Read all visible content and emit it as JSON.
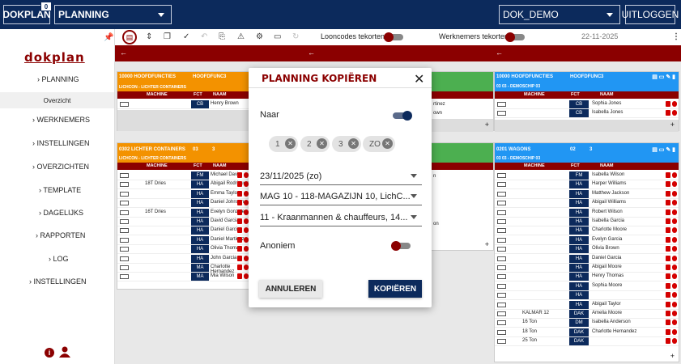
{
  "topbar": {
    "app_label": "DOKPLAN",
    "badge": "0",
    "module": "PLANNING",
    "environment": "DOK_DEMO",
    "logout": "UITLOGGEN"
  },
  "sidebar": {
    "logo": "dokplan",
    "items": [
      {
        "label": "PLANNING"
      },
      {
        "label": "Overzicht"
      },
      {
        "label": "WERKNEMERS"
      },
      {
        "label": "INSTELLINGEN"
      },
      {
        "label": "OVERZICHTEN"
      },
      {
        "label": "TEMPLATE"
      },
      {
        "label": "DAGELIJKS"
      },
      {
        "label": "RAPPORTEN"
      },
      {
        "label": "LOG"
      },
      {
        "label": "INSTELLINGEN"
      }
    ]
  },
  "toolbar": {
    "looncodes": "Looncodes tekorten",
    "werknemers": "Werknemers tekorten",
    "date": "22-11-2025"
  },
  "colors": {
    "navy": "#0c2a5c",
    "red": "#8b0000",
    "orange": "#f39200",
    "green": "#4caf50",
    "blue": "#2196f3"
  },
  "cards": {
    "c1": {
      "code": "10000 HOOFDFUNCTIES",
      "type": "HOOFDFUNC",
      "num": "3",
      "sub": "LICHCON - LICHTER CONTAINERS",
      "h_machine": "MACHINE",
      "h_fct": "FCT",
      "h_naam": "NAAM",
      "rows": [
        {
          "m": "",
          "f": "CB",
          "n": "Henry Brown"
        }
      ]
    },
    "c2": {
      "code": "0302 LICHTER CONTAINERS",
      "type": "03",
      "num": "3",
      "sub": "LICHCON - LICHTER CONTAINERS",
      "h_machine": "MACHINE",
      "h_fct": "FCT",
      "h_naam": "NAAM",
      "rows": [
        {
          "m": "",
          "f": "FM",
          "n": "Michael Davis"
        },
        {
          "m": "18T Dries",
          "f": "HA",
          "n": "Abigail Rodriguez"
        },
        {
          "m": "",
          "f": "HA",
          "n": "Emma Taylor"
        },
        {
          "m": "",
          "f": "HA",
          "n": "Daniel Johnson"
        },
        {
          "m": "16T Dries",
          "f": "HA",
          "n": "Evelyn Gonzalez"
        },
        {
          "m": "",
          "f": "HA",
          "n": "David Garcia"
        },
        {
          "m": "",
          "f": "HA",
          "n": "Daniel Garcia"
        },
        {
          "m": "",
          "f": "HA",
          "n": "Daniel Martinez"
        },
        {
          "m": "",
          "f": "HA",
          "n": "Olivia Thomas"
        },
        {
          "m": "",
          "f": "HA",
          "n": "John Garcia"
        },
        {
          "m": "",
          "f": "MA",
          "n": "Charlotte Hernandez"
        },
        {
          "m": "",
          "f": "MA",
          "n": "Mia Wilson"
        }
      ]
    },
    "c3": {
      "rows": [
        {
          "n": "rtinez"
        },
        {
          "n": "own"
        }
      ]
    },
    "c4": {
      "rows": [
        {
          "n": "n"
        },
        {
          "n": ""
        },
        {
          "n": ""
        },
        {
          "n": ""
        },
        {
          "n": ""
        },
        {
          "n": "on"
        }
      ]
    },
    "c5": {
      "code": "10000 HOOFDFUNCTIES",
      "type": "HOOFDFUNC",
      "num": "3",
      "sub": "03 03 - DEMOSCHIP 03",
      "h_machine": "MACHINE",
      "h_fct": "FCT",
      "h_naam": "NAAM",
      "rows": [
        {
          "m": "",
          "f": "CB",
          "n": "Sophia Jones"
        },
        {
          "m": "",
          "f": "CB",
          "n": "Isabella Jones"
        }
      ]
    },
    "c6": {
      "code": "0201 WAGONS",
      "type": "02",
      "num": "3",
      "sub": "03 03 - DEMOSCHIP 03",
      "h_machine": "MACHINE",
      "h_fct": "FCT",
      "h_naam": "NAAM",
      "rows": [
        {
          "m": "",
          "f": "FM",
          "n": "Isabella Wilson"
        },
        {
          "m": "",
          "f": "HA",
          "n": "Harper Williams"
        },
        {
          "m": "",
          "f": "HA",
          "n": "Matthew Jackson"
        },
        {
          "m": "",
          "f": "HA",
          "n": "Abigail Williams"
        },
        {
          "m": "",
          "f": "HA",
          "n": "Robert Wilson"
        },
        {
          "m": "",
          "f": "HA",
          "n": "Isabella Garcia"
        },
        {
          "m": "",
          "f": "HA",
          "n": "Charlotte Moore"
        },
        {
          "m": "",
          "f": "HA",
          "n": "Evelyn Garcia"
        },
        {
          "m": "",
          "f": "HA",
          "n": "Olivia Brown"
        },
        {
          "m": "",
          "f": "HA",
          "n": "Daniel Garcia"
        },
        {
          "m": "",
          "f": "HA",
          "n": "Abigail Moore"
        },
        {
          "m": "",
          "f": "HA",
          "n": "Henry Thomas"
        },
        {
          "m": "",
          "f": "HA",
          "n": "Sophia Moore"
        },
        {
          "m": "",
          "f": "HA",
          "n": ""
        },
        {
          "m": "",
          "f": "HA",
          "n": "Abigail Taylor"
        },
        {
          "m": "KALMAR 12",
          "f": "DAK",
          "n": "Amelia Moore"
        },
        {
          "m": "16 Ton",
          "f": "DM",
          "n": "Isabella Anderson"
        },
        {
          "m": "18 Ton",
          "f": "DAK",
          "n": "Charlotte Hernandez"
        },
        {
          "m": "25 Ton",
          "f": "DAK",
          "n": ""
        }
      ]
    }
  },
  "modal": {
    "title": "PLANNING KOPIËREN",
    "naar": "Naar",
    "chips": [
      "1",
      "2",
      "3",
      "ZO"
    ],
    "date": "23/11/2025 (zo)",
    "location": "MAG 10 - 118-MAGAZIJN 10, LichC...",
    "team": "11 - Kraanmannen & chauffeurs, 14...",
    "anoniem": "Anoniem",
    "cancel": "ANNULEREN",
    "copy": "KOPIËREN"
  }
}
